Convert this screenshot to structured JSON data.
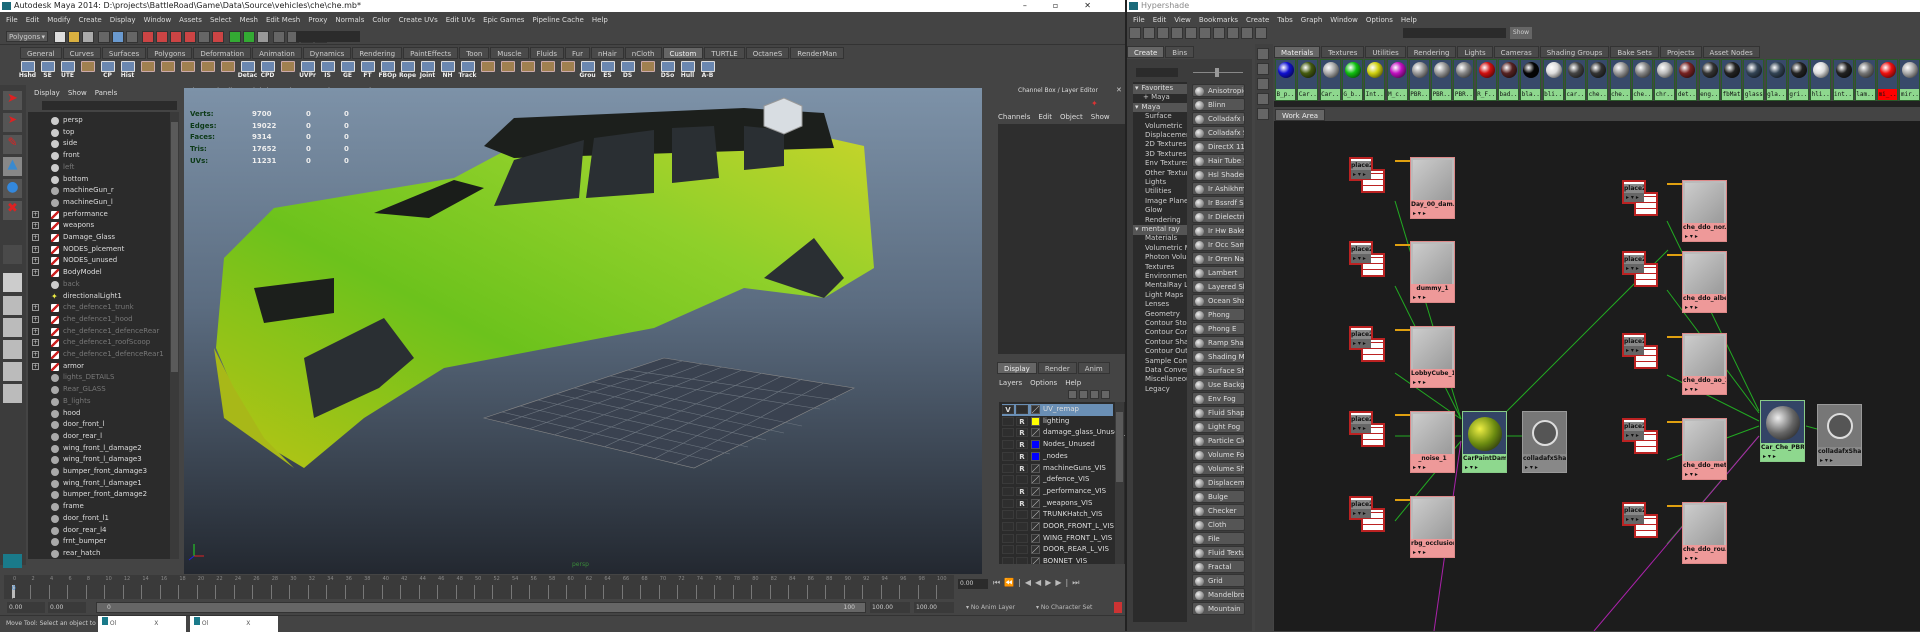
{
  "maya": {
    "title": "Autodesk Maya 2014: D:\\projects\\BattleRoad\\Game\\Data\\Source\\vehicles\\che\\che.mb*",
    "menu": [
      "File",
      "Edit",
      "Modify",
      "Create",
      "Display",
      "Window",
      "Assets",
      "Select",
      "Mesh",
      "Edit Mesh",
      "Proxy",
      "Normals",
      "Color",
      "Create UVs",
      "Edit UVs",
      "Epic Games",
      "Pipeline Cache",
      "Help"
    ],
    "menuset": "Polygons",
    "shelf_tabs": [
      "General",
      "Curves",
      "Surfaces",
      "Polygons",
      "Deformation",
      "Animation",
      "Dynamics",
      "Rendering",
      "PaintEffects",
      "Toon",
      "Muscle",
      "Fluids",
      "Fur",
      "nHair",
      "nCloth",
      "Custom",
      "TURTLE",
      "OctaneS",
      "RenderMan"
    ],
    "active_shelf": "Custom",
    "shelf_buttons": [
      "Hshd",
      "SE",
      "UTE",
      "",
      "CP",
      "Hist",
      "",
      "",
      "",
      "",
      "",
      "Detac",
      "CPD",
      "",
      "UVPr",
      "IS",
      "GE",
      "FT",
      "FBOp",
      "Rope",
      "Joint",
      "NH",
      "Track",
      "",
      "",
      "",
      "",
      "",
      "Grou",
      "ES",
      "DS",
      "",
      "DSo",
      "Hull",
      "A-B"
    ],
    "outliner": {
      "menu": [
        "Display",
        "Show",
        "Panels"
      ],
      "items": [
        {
          "label": "persp",
          "icon": "camera"
        },
        {
          "label": "top",
          "icon": "camera"
        },
        {
          "label": "side",
          "icon": "camera"
        },
        {
          "label": "front",
          "icon": "camera"
        },
        {
          "label": "left",
          "icon": "camera",
          "dim": true
        },
        {
          "label": "bottom",
          "icon": "camera"
        },
        {
          "label": "machineGun_r",
          "icon": "transform"
        },
        {
          "label": "machineGun_l",
          "icon": "transform"
        },
        {
          "label": "performance",
          "icon": "group",
          "exp": true
        },
        {
          "label": "weapons",
          "icon": "group",
          "exp": true
        },
        {
          "label": "Damage_Glass",
          "icon": "group",
          "exp": true
        },
        {
          "label": "NODES_plcement",
          "icon": "group",
          "exp": true
        },
        {
          "label": "NODES_unused",
          "icon": "group",
          "exp": true
        },
        {
          "label": "BodyModel",
          "icon": "group",
          "exp": true
        },
        {
          "label": "back",
          "icon": "camera",
          "dim": true
        },
        {
          "label": "directionalLight1",
          "icon": "light"
        },
        {
          "label": "che_defence1_trunk",
          "icon": "group",
          "exp": true,
          "dim": true
        },
        {
          "label": "che_defence1_hood",
          "icon": "group",
          "exp": true,
          "dim": true
        },
        {
          "label": "che_defence1_defenceRear",
          "icon": "group",
          "exp": true,
          "dim": true
        },
        {
          "label": "che_defence1_roofScoop",
          "icon": "group",
          "exp": true,
          "dim": true
        },
        {
          "label": "che_defence1_defenceRear1",
          "icon": "group",
          "exp": true,
          "dim": true
        },
        {
          "label": "armor",
          "icon": "group",
          "exp": true
        },
        {
          "label": "lights_DETAILS",
          "icon": "transform",
          "dim": true
        },
        {
          "label": "Rear_GLASS",
          "icon": "transform",
          "dim": true
        },
        {
          "label": "B_lights",
          "icon": "transform",
          "dim": true
        },
        {
          "label": "hood",
          "icon": "transform"
        },
        {
          "label": "door_front_l",
          "icon": "transform"
        },
        {
          "label": "door_rear_l",
          "icon": "transform"
        },
        {
          "label": "wing_front_l_damage2",
          "icon": "transform"
        },
        {
          "label": "wing_front_l_damage3",
          "icon": "transform"
        },
        {
          "label": "bumper_front_damage3",
          "icon": "transform"
        },
        {
          "label": "wing_front_l_damage1",
          "icon": "transform"
        },
        {
          "label": "bumper_front_damage2",
          "icon": "transform"
        },
        {
          "label": "frame",
          "icon": "transform"
        },
        {
          "label": "door_front_l1",
          "icon": "transform"
        },
        {
          "label": "door_rear_l4",
          "icon": "transform"
        },
        {
          "label": "frnt_bumper",
          "icon": "transform"
        },
        {
          "label": "rear_hatch",
          "icon": "transform"
        }
      ]
    },
    "viewport": {
      "menu": [
        "View",
        "Shading",
        "Lighting",
        "Show",
        "Renderer",
        "Panels"
      ],
      "hud": [
        {
          "label": "Verts:",
          "v": [
            "9700",
            "0",
            "0"
          ]
        },
        {
          "label": "Edges:",
          "v": [
            "19022",
            "0",
            "0"
          ]
        },
        {
          "label": "Faces:",
          "v": [
            "9314",
            "0",
            "0"
          ]
        },
        {
          "label": "Tris:",
          "v": [
            "17652",
            "0",
            "0"
          ]
        },
        {
          "label": "UVs:",
          "v": [
            "11231",
            "0",
            "0"
          ]
        }
      ],
      "camera": "persp",
      "body_color": "#6fc21c"
    },
    "channel_box": {
      "title": "Channel Box / Layer Editor",
      "menu": [
        "Channels",
        "Edit",
        "Object",
        "Show"
      ],
      "layer_tabs": [
        "Display",
        "Render",
        "Anim"
      ],
      "layer_menu": [
        "Layers",
        "Options",
        "Help"
      ],
      "layers": [
        {
          "name": "UV_remap",
          "v": "V",
          "r": "",
          "color": "",
          "selected": true
        },
        {
          "name": "lighting",
          "v": "",
          "r": "R",
          "color": "#ffff00"
        },
        {
          "name": "damage_glass_Unused_VIS",
          "v": "",
          "r": "R",
          "color": ""
        },
        {
          "name": "Nodes_Unused",
          "v": "",
          "r": "R",
          "color": "#0000ff"
        },
        {
          "name": "_nodes",
          "v": "",
          "r": "R",
          "color": "#0000ff"
        },
        {
          "name": "machineGuns_VIS",
          "v": "",
          "r": "R",
          "color": ""
        },
        {
          "name": "_defence_VIS",
          "v": "",
          "r": "",
          "color": ""
        },
        {
          "name": "_performance_VIS",
          "v": "",
          "r": "R",
          "color": ""
        },
        {
          "name": "_weapons_VIS",
          "v": "",
          "r": "R",
          "color": ""
        },
        {
          "name": "TRUNKHatch_VIS",
          "v": "",
          "r": "",
          "color": ""
        },
        {
          "name": "DOOR_FRONT_L_VIS",
          "v": "",
          "r": "",
          "color": ""
        },
        {
          "name": "WING_FRONT_L_VIS",
          "v": "",
          "r": "",
          "color": ""
        },
        {
          "name": "DOOR_REAR_L_VIS",
          "v": "",
          "r": "",
          "color": ""
        },
        {
          "name": "BONNET_VIS",
          "v": "",
          "r": "",
          "color": ""
        }
      ]
    },
    "timeline": {
      "start": 0,
      "end": 100,
      "step": 2,
      "current_frame": "0.00",
      "current_marker": "0"
    },
    "range": {
      "start": "0.00",
      "anim_start": "0.00",
      "slider_start": "0",
      "slider_end": "100",
      "anim_end": "100.00",
      "end": "100.00",
      "anim_layer": "No Anim Layer",
      "char_set": "No Character Set"
    },
    "help_line": "Move Tool: Select an object to",
    "popups": [
      "Ol",
      "Ol"
    ]
  },
  "hypershade": {
    "title": "Hypershade",
    "menu": [
      "File",
      "Edit",
      "View",
      "Bookmarks",
      "Create",
      "Tabs",
      "Graph",
      "Window",
      "Options",
      "Help"
    ],
    "show_button": "Show",
    "left_tabs": [
      "Create",
      "Bins"
    ],
    "tree": [
      {
        "label": "Favorites",
        "hdr": true
      },
      {
        "label": "+ Maya",
        "ind": 1
      },
      {
        "label": "Maya",
        "hdr": true
      },
      {
        "label": "Surface",
        "ind": 2
      },
      {
        "label": "Volumetric",
        "ind": 2
      },
      {
        "label": "Displacement",
        "ind": 2
      },
      {
        "label": "2D Textures",
        "ind": 2
      },
      {
        "label": "3D Textures",
        "ind": 2
      },
      {
        "label": "Env Textures",
        "ind": 2
      },
      {
        "label": "Other Textures",
        "ind": 2
      },
      {
        "label": "Lights",
        "ind": 2
      },
      {
        "label": "Utilities",
        "ind": 2
      },
      {
        "label": "Image Planes",
        "ind": 2
      },
      {
        "label": "Glow",
        "ind": 2
      },
      {
        "label": "Rendering",
        "ind": 2
      },
      {
        "label": "mental ray",
        "hdr": true
      },
      {
        "label": "Materials",
        "ind": 2
      },
      {
        "label": "Volumetric Ma...",
        "ind": 2
      },
      {
        "label": "Photon Volum...",
        "ind": 2
      },
      {
        "label": "Textures",
        "ind": 2
      },
      {
        "label": "Environments",
        "ind": 2
      },
      {
        "label": "MentalRay Lig...",
        "ind": 2
      },
      {
        "label": "Light Maps",
        "ind": 2
      },
      {
        "label": "Lenses",
        "ind": 2
      },
      {
        "label": "Geometry",
        "ind": 2
      },
      {
        "label": "Contour Store",
        "ind": 2
      },
      {
        "label": "Contour Cont...",
        "ind": 2
      },
      {
        "label": "Contour Shade",
        "ind": 2
      },
      {
        "label": "Contour Outpu...",
        "ind": 2
      },
      {
        "label": "Sample Comp...",
        "ind": 2
      },
      {
        "label": "Data Conversi...",
        "ind": 2
      },
      {
        "label": "Miscellaneous",
        "ind": 2
      },
      {
        "label": "Legacy",
        "ind": 2
      }
    ],
    "node_buttons": [
      "Anisotropic",
      "Blinn",
      "Colladafx F",
      "Colladafx S",
      "DirectX 11",
      "Hair Tube S",
      "Hsl Shader",
      "Ir Ashikhm",
      "Ir Bssrdf S",
      "Ir Dielectri",
      "Ir Hw Bake",
      "Ir Occ Sam",
      "Ir Oren Na",
      "Lambert",
      "Layered Sh",
      "Ocean Sha",
      "Phong",
      "Phong E",
      "Ramp Shad",
      "Shading Ma",
      "Surface Sh",
      "Use Backgr",
      "Env Fog",
      "Fluid Shape",
      "Light Fog",
      "Particle Clo",
      "Volume Fog",
      "Volume Sha",
      "Displaceme",
      "Bulge",
      "Checker",
      "Cloth",
      "File",
      "Fluid Textu",
      "Fractal",
      "Grid",
      "Mandelbro",
      "Mountain"
    ],
    "tabs": [
      "Materials",
      "Textures",
      "Utilities",
      "Rendering",
      "Lights",
      "Cameras",
      "Shading Groups",
      "Bake Sets",
      "Projects",
      "Asset Nodes"
    ],
    "active_tab": "Materials",
    "materials": [
      {
        "label": "B_p..",
        "color": "#1010d0"
      },
      {
        "label": "Car..",
        "color": "#445a10"
      },
      {
        "label": "Car..",
        "color": "#aaaaaa"
      },
      {
        "label": "G_b..",
        "color": "#10c010"
      },
      {
        "label": "Int..",
        "color": "#d0d010"
      },
      {
        "label": "M_c..",
        "color": "#c010c0"
      },
      {
        "label": "PBR..",
        "color": "#999999"
      },
      {
        "label": "PBR..",
        "color": "#999999"
      },
      {
        "label": "PBR..",
        "color": "#888888"
      },
      {
        "label": "R_F..",
        "color": "#d01010"
      },
      {
        "label": "bad..",
        "color": "#552222"
      },
      {
        "label": "bla..",
        "color": "#050505"
      },
      {
        "label": "bli..",
        "color": "#dddddd"
      },
      {
        "label": "car..",
        "color": "#444444"
      },
      {
        "label": "che..",
        "color": "#333333"
      },
      {
        "label": "che..",
        "color": "#999999"
      },
      {
        "label": "che..",
        "color": "#888888"
      },
      {
        "label": "chr..",
        "color": "#bbbbbb"
      },
      {
        "label": "det..",
        "color": "#772222"
      },
      {
        "label": "eng..",
        "color": "#333333"
      },
      {
        "label": "fbMat",
        "color": "#222222"
      },
      {
        "label": "glass",
        "color": "#334455"
      },
      {
        "label": "gla..",
        "color": "#334455"
      },
      {
        "label": "gri..",
        "color": "#222222"
      },
      {
        "label": "hli..",
        "color": "#dddddd"
      },
      {
        "label": "int..",
        "color": "#222222"
      },
      {
        "label": "lam..",
        "color": "#777777"
      },
      {
        "label": "mi_..",
        "color": "#ee1010",
        "error": true
      },
      {
        "label": "mir..",
        "color": "#aaaaaa"
      }
    ],
    "work_area_tab": "Work Area",
    "nodes": {
      "left_place2d": "place2dTextu...",
      "left_textures": [
        "Day_00_dam...",
        "dummy_1",
        "LobbyCube_1",
        "_noise_1",
        "rbg_occlusion..."
      ],
      "left_material": "CarPaintDam...",
      "left_sg": "colladafxSha...",
      "right_place2d": "place2dTextu...",
      "right_textures": [
        "che_ddo_nor...",
        "che_ddo_albe...",
        "che_ddo_ao_1",
        "che_ddo_met...",
        "che_ddo_rou..."
      ],
      "right_material": "Car_Che_PBR",
      "right_sg": "colladafxSha..."
    }
  }
}
